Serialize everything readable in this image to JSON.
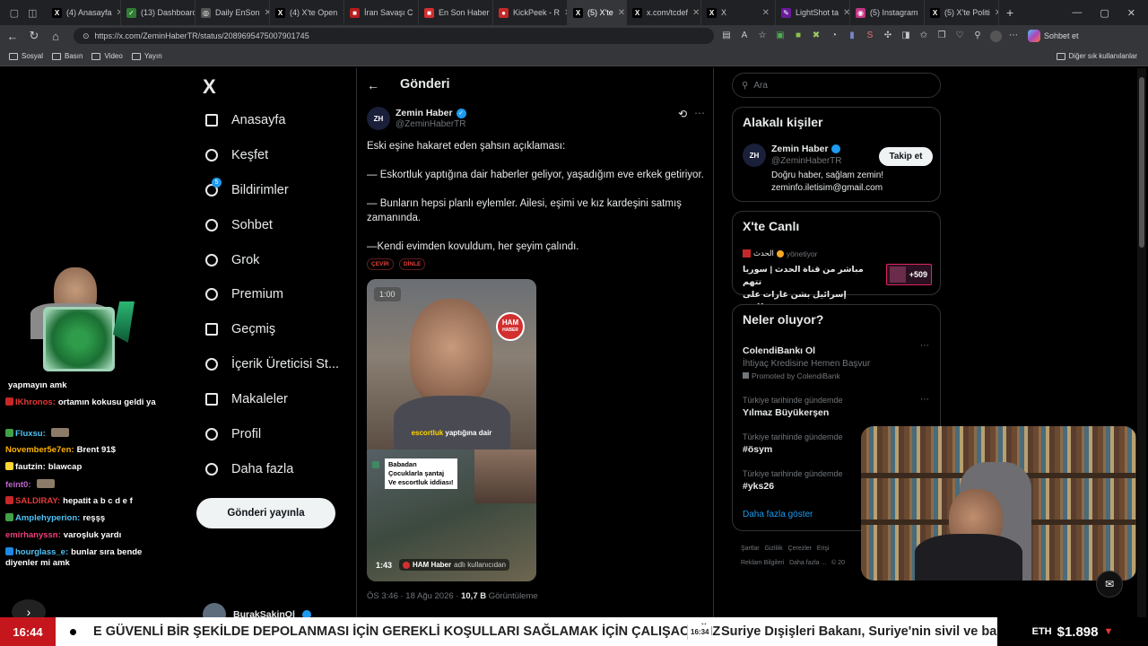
{
  "browser": {
    "tabs": [
      {
        "label": "(4) Anasayfa",
        "color": "#000000",
        "glyph": "X"
      },
      {
        "label": "(13) Dashboard",
        "color": "#2e7d32",
        "glyph": "✓"
      },
      {
        "label": "Daily EnSon",
        "color": "#555555",
        "glyph": "◎"
      },
      {
        "label": "(4) X'te Open",
        "color": "#000000",
        "glyph": "X"
      },
      {
        "label": "İran Savaşı C",
        "color": "#b71c1c",
        "glyph": "■"
      },
      {
        "label": "En Son Haber",
        "color": "#d32f2f",
        "glyph": "■"
      },
      {
        "label": "KickPeek - R",
        "color": "#c62828",
        "glyph": "●"
      },
      {
        "label": "(5) X'te",
        "color": "#000000",
        "glyph": "X"
      },
      {
        "label": "x.com/tcdef",
        "color": "#000000",
        "glyph": "X"
      },
      {
        "label": "X",
        "color": "#000000",
        "glyph": "X"
      },
      {
        "label": "LightShot ta",
        "color": "#6a1b9a",
        "glyph": "✎"
      },
      {
        "label": "(5) Instagram",
        "color": "#c13584",
        "glyph": "◉"
      },
      {
        "label": "(5) X'te Politi",
        "color": "#000000",
        "glyph": "X"
      }
    ],
    "new_tab": "+",
    "url": "https://x.com/ZeminHaberTR/status/2089695475007901745",
    "sohbet_et": "Sohbet et",
    "bookmarks": [
      "Sosyal",
      "Basın",
      "Video",
      "Yayın"
    ],
    "other_bookmarks": "Diğer sık kullanılanlar"
  },
  "sidebar": {
    "logo": "X",
    "items": [
      {
        "label": "Anasayfa",
        "icon": "home-icon"
      },
      {
        "label": "Keşfet",
        "icon": "search-icon"
      },
      {
        "label": "Bildirimler",
        "icon": "bell-icon",
        "badge": "5"
      },
      {
        "label": "Sohbet",
        "icon": "chat-icon"
      },
      {
        "label": "Grok",
        "icon": "grok-icon"
      },
      {
        "label": "Premium",
        "icon": "premium-icon"
      },
      {
        "label": "Geçmiş",
        "icon": "bookmark-icon"
      },
      {
        "label": "İçerik Üreticisi St...",
        "icon": "rocket-icon"
      },
      {
        "label": "Makaleler",
        "icon": "article-icon"
      },
      {
        "label": "Profil",
        "icon": "person-icon"
      },
      {
        "label": "Daha fazla",
        "icon": "more-icon"
      }
    ],
    "post_button": "Gönderi yayınla",
    "account_name": "BurakSakinOl"
  },
  "post": {
    "header": "Gönderi",
    "author_name": "Zemin Haber",
    "author_handle": "@ZeminHaberTR",
    "avatar_text": "ZH",
    "text_lines": [
      "Eski eşine hakaret eden şahsın açıklaması:",
      "— Eskortluk yaptığına dair haberler geliyor, yaşadığım eve erkek getiriyor.",
      "— Bunların hepsi planlı eylemler. Ailesi, eşimi ve kız kardeşini satmış zamanında.",
      "—Kendi evimden kovuldum, her şeyim çalındı."
    ],
    "translate": "ÇEVİR",
    "listen": "DİNLE",
    "video": {
      "top_duration": "1:00",
      "logo_top": "HAM",
      "logo_bottom": "HABER",
      "subtitle_highlight": "escortluk",
      "subtitle_rest": "yaptığına dair",
      "inset_line1": "Babadan",
      "inset_line2": "Çocuklarla şantaj",
      "inset_line3": "Ve escortluk iddiası!",
      "bottom_duration": "1:43",
      "credit_source": "HAM Haber",
      "credit_suffix": "adlı kullanıcıdan"
    },
    "timestamp": "ÖS 3:46 · 18 Ağu 2026 · ",
    "views_count": "10,7 B",
    "views_label": "Görüntüleme"
  },
  "right": {
    "search_placeholder": "Ara",
    "related_title": "Alakalı kişiler",
    "related": {
      "name": "Zemin Haber",
      "handle": "@ZeminHaberTR",
      "bio_line1": "Doğru haber, sağlam zemin!",
      "bio_line2": "zeminfo.iletisim@gmail.com",
      "follow": "Takip et"
    },
    "live_title": "X'te Canlı",
    "live": {
      "source": "الحدث",
      "status": "yönetiyor",
      "text_line1": "مباشر من قناة الحدث | سوريا تتهم",
      "text_line2": "إسرائيل بشن غارات على مطار ...",
      "count": "+509"
    },
    "trends_title": "Neler oluyor?",
    "trends": [
      {
        "cat": "",
        "name": "ColendiBankı Ol",
        "sub": "İhtiyaç Kredisine Hemen Başvur",
        "promo": "Promoted by ColendiBank"
      },
      {
        "cat": "Türkiye tarihinde gündemde",
        "name": "Yılmaz Büyükerşen"
      },
      {
        "cat": "Türkiye tarihinde gündemde",
        "name": "#ösym"
      },
      {
        "cat": "Türkiye tarihinde gündemde",
        "name": "#yks26"
      }
    ],
    "show_more": "Daha fazla göster",
    "footer": [
      "Şartlar",
      "Gizlilik",
      "Çerezler",
      "Erişi",
      "Reklam Bilgileri",
      "Daha fazla ...",
      "© 20"
    ]
  },
  "chat": [
    {
      "user": "",
      "msg": "yapmayın amk",
      "color": "#ffffff",
      "badge": ""
    },
    {
      "user": "IKhronos:",
      "msg": "ortamın kokusu geldi ya",
      "color": "#e53935",
      "badge": "#c62828"
    },
    {
      "user": "Fluxsu:",
      "msg": "",
      "color": "#4fc3f7",
      "badge": "#43a047"
    },
    {
      "user": "November5e7en:",
      "msg": "Brent 91$",
      "color": "#ffb300",
      "badge": ""
    },
    {
      "user": "fautzin:",
      "msg": "blawcap",
      "color": "#ffffff",
      "badge": "#fdd835"
    },
    {
      "user": "feint0:",
      "msg": "",
      "color": "#ba68c8",
      "badge": ""
    },
    {
      "user": "SALDIRAY:",
      "msg": "hepatit a b c d e f",
      "color": "#e53935",
      "badge": "#c62828"
    },
    {
      "user": "Amplehyperion:",
      "msg": "reşşş",
      "color": "#4fc3f7",
      "badge": "#43a047"
    },
    {
      "user": "emirhanyssn:",
      "msg": "varoşluk yardı",
      "color": "#ec407a",
      "badge": ""
    },
    {
      "user": "hourglass_e:",
      "msg": "bunlar sıra bende diyenler mi amk",
      "color": "#4fc3f7",
      "badge": "#1e88e5"
    }
  ],
  "ticker": {
    "time": "16:44",
    "headline1": "E GÜVENLİ BİR ŞEKİLDE DEPOLANMASI İÇİN GEREKLİ KOŞULLARI SAĞLAMAK İÇİN ÇALIŞACAĞIZ",
    "time2": "16:34",
    "headline2": "Suriye Dışişleri Bakanı, Suriye'nin sivil ve barışç",
    "coin": "ETH",
    "price": "$1.898",
    "arrow": "▼"
  },
  "colors": {
    "accent": "#1d9bf0",
    "verified": "#1d9bf0",
    "ticker_red": "#c4161c"
  }
}
